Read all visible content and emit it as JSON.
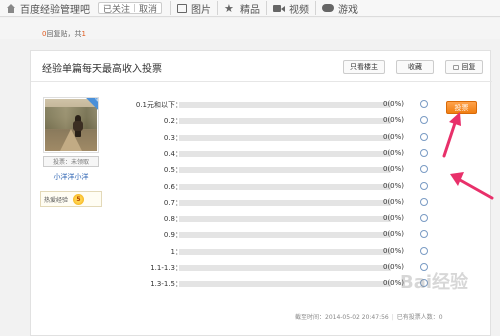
{
  "nav": {
    "forum_name": "百度经验管理吧",
    "followed": "已关注",
    "cancel": "取消",
    "pictures": "图片",
    "featured": "精品",
    "videos": "视频",
    "games": "游戏"
  },
  "thread_meta": {
    "reply_count_num": "0",
    "reply_label": "回复贴，共",
    "page_count": "1"
  },
  "post": {
    "title": "经验单篇每天最高收入投票",
    "only_author": "只看楼主",
    "favorite": "收藏",
    "reply": "回复"
  },
  "user": {
    "badge": "楼主",
    "ip_label": "投票：未领取",
    "name": "小洋洋小洋",
    "exp_label": "热爱经验",
    "level": "5"
  },
  "poll": {
    "vote_button": "投票",
    "options": [
      {
        "label": "0.1元和以下：",
        "count": "0(0%)",
        "fraction": 0
      },
      {
        "label": "0.2：",
        "count": "0(0%)",
        "fraction": 0
      },
      {
        "label": "0.3：",
        "count": "0(0%)",
        "fraction": 0
      },
      {
        "label": "0.4：",
        "count": "0(0%)",
        "fraction": 0
      },
      {
        "label": "0.5：",
        "count": "0(0%)",
        "fraction": 0
      },
      {
        "label": "0.6：",
        "count": "0(0%)",
        "fraction": 0
      },
      {
        "label": "0.7：",
        "count": "0(0%)",
        "fraction": 0
      },
      {
        "label": "0.8：",
        "count": "0(0%)",
        "fraction": 0
      },
      {
        "label": "0.9：",
        "count": "0(0%)",
        "fraction": 0
      },
      {
        "label": "1：",
        "count": "0(0%)",
        "fraction": 0
      },
      {
        "label": "1.1-1.3：",
        "count": "0(0%)",
        "fraction": 0
      },
      {
        "label": "1.3-1.5：",
        "count": "0(0%)",
        "fraction": 0
      }
    ],
    "deadline": "截至时间：2014-05-02 20:47:56",
    "voters": "已有投票人数：0"
  },
  "colors": {
    "accent_blue": "#4a90d9",
    "vote_orange": "#f07e12",
    "arrow_pink": "#e8306a"
  },
  "watermark": "Bai经验"
}
